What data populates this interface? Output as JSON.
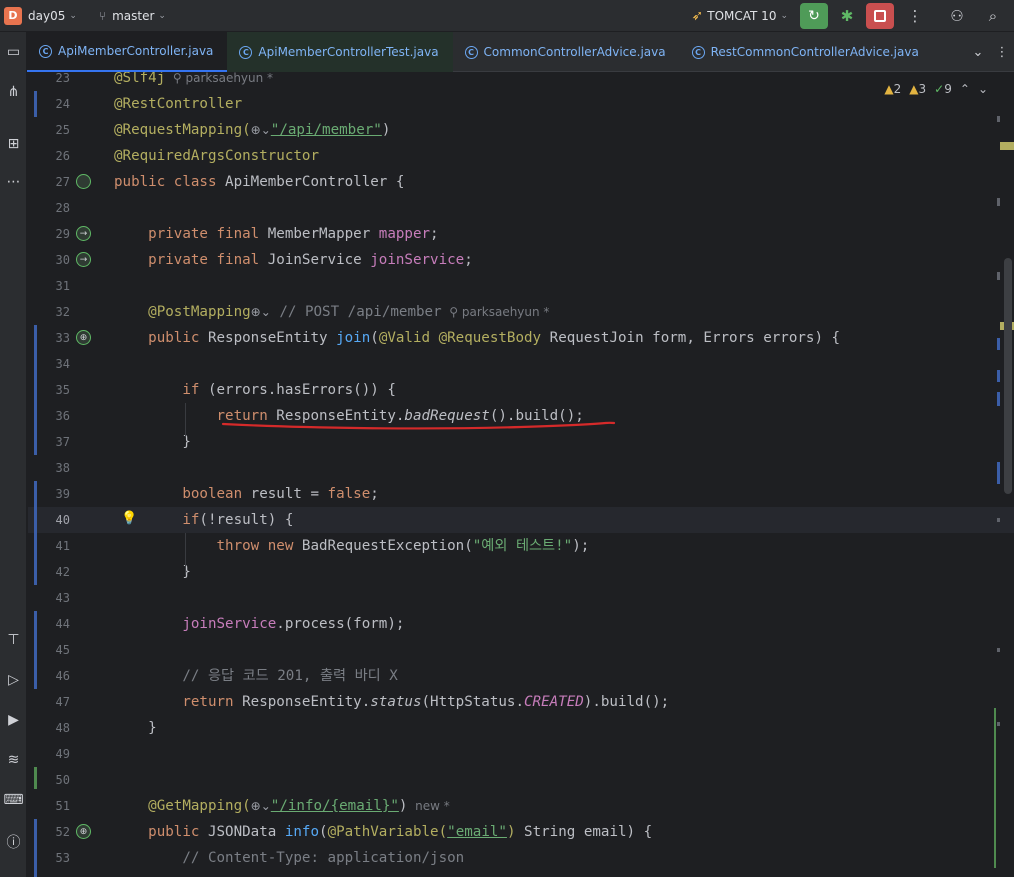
{
  "toolbar": {
    "project_badge": "D",
    "project_name": "day05",
    "branch": "master",
    "run_config": "TOMCAT 10"
  },
  "tabs": [
    {
      "label": "ApiMemberController.java",
      "active": true
    },
    {
      "label": "ApiMemberControllerTest.java",
      "modified": true
    },
    {
      "label": "CommonControllerAdvice.java"
    },
    {
      "label": "RestCommonControllerAdvice.java"
    }
  ],
  "inspections": {
    "warnings": "2",
    "weak_warnings": "3",
    "ok": "9"
  },
  "author_hint": "parksaehyun *",
  "new_hint": "new *",
  "code_lines": [
    {
      "n": "23",
      "tokens": [
        [
          "t-ann",
          "@Slf4j"
        ],
        [
          "t-meta",
          "  ⚲ parksaehyun *"
        ]
      ]
    },
    {
      "n": "24",
      "tokens": [
        [
          "t-ann",
          "@RestController"
        ]
      ]
    },
    {
      "n": "25",
      "tokens": [
        [
          "t-ann",
          "@RequestMapping("
        ],
        [
          "t-globe",
          "⊕⌄"
        ],
        [
          "t-str t-link",
          "\"/api/member\""
        ],
        [
          "t-plain",
          ")"
        ]
      ]
    },
    {
      "n": "26",
      "tokens": [
        [
          "t-ann",
          "@RequiredArgsConstructor"
        ]
      ]
    },
    {
      "n": "27",
      "tokens": [
        [
          "t-kw",
          "public class "
        ],
        [
          "t-plain",
          "ApiMemberController {"
        ]
      ]
    },
    {
      "n": "28",
      "tokens": []
    },
    {
      "n": "29",
      "tokens": [
        [
          "t-kw",
          "    private final "
        ],
        [
          "t-plain",
          "MemberMapper "
        ],
        [
          "t-field",
          "mapper"
        ],
        [
          "t-plain",
          ";"
        ]
      ]
    },
    {
      "n": "30",
      "tokens": [
        [
          "t-kw",
          "    private final "
        ],
        [
          "t-plain",
          "JoinService "
        ],
        [
          "t-field",
          "joinService"
        ],
        [
          "t-plain",
          ";"
        ]
      ]
    },
    {
      "n": "31",
      "tokens": []
    },
    {
      "n": "32",
      "tokens": [
        [
          "t-ann",
          "    @PostMapping"
        ],
        [
          "t-globe",
          "⊕⌄"
        ],
        [
          "t-cmt",
          " // POST /api/member"
        ],
        [
          "t-meta",
          "  ⚲ parksaehyun *"
        ]
      ]
    },
    {
      "n": "33",
      "tokens": [
        [
          "t-kw",
          "    public "
        ],
        [
          "t-plain",
          "ResponseEntity "
        ],
        [
          "t-fn",
          "join"
        ],
        [
          "t-plain",
          "("
        ],
        [
          "t-ann",
          "@Valid @RequestBody "
        ],
        [
          "t-plain",
          "RequestJoin form, Errors errors) {"
        ]
      ]
    },
    {
      "n": "34",
      "tokens": []
    },
    {
      "n": "35",
      "tokens": [
        [
          "t-kw",
          "        if "
        ],
        [
          "t-plain",
          "(errors.hasErrors()) {"
        ]
      ]
    },
    {
      "n": "36",
      "tokens": [
        [
          "t-kw",
          "            return "
        ],
        [
          "t-plain",
          "ResponseEntity."
        ],
        [
          "t-plain t-italic",
          "badRequest"
        ],
        [
          "t-plain",
          "().build();"
        ]
      ]
    },
    {
      "n": "37",
      "tokens": [
        [
          "t-plain",
          "        }"
        ]
      ]
    },
    {
      "n": "38",
      "tokens": []
    },
    {
      "n": "39",
      "tokens": [
        [
          "t-kw",
          "        boolean "
        ],
        [
          "t-plain",
          "result = "
        ],
        [
          "t-kw",
          "false"
        ],
        [
          "t-plain",
          ";"
        ]
      ]
    },
    {
      "n": "40",
      "tokens": [
        [
          "t-kw",
          "        if"
        ],
        [
          "t-plain",
          "(!result) {"
        ]
      ]
    },
    {
      "n": "41",
      "tokens": [
        [
          "t-kw",
          "            throw new "
        ],
        [
          "t-plain",
          "BadRequestException("
        ],
        [
          "t-str",
          "\"예외 테스트!\""
        ],
        [
          "t-plain",
          ");"
        ]
      ]
    },
    {
      "n": "42",
      "tokens": [
        [
          "t-plain",
          "        }"
        ]
      ]
    },
    {
      "n": "43",
      "tokens": []
    },
    {
      "n": "44",
      "tokens": [
        [
          "t-field",
          "        joinService"
        ],
        [
          "t-plain",
          ".process(form);"
        ]
      ]
    },
    {
      "n": "45",
      "tokens": []
    },
    {
      "n": "46",
      "tokens": [
        [
          "t-cmt",
          "        // 응답 코드 201, 출력 바디 X"
        ]
      ]
    },
    {
      "n": "47",
      "tokens": [
        [
          "t-kw",
          "        return "
        ],
        [
          "t-plain",
          "ResponseEntity."
        ],
        [
          "t-plain t-italic",
          "status"
        ],
        [
          "t-plain",
          "(HttpStatus."
        ],
        [
          "t-const",
          "CREATED"
        ],
        [
          "t-plain",
          ").build();"
        ]
      ]
    },
    {
      "n": "48",
      "tokens": [
        [
          "t-plain",
          "    }"
        ]
      ]
    },
    {
      "n": "49",
      "tokens": []
    },
    {
      "n": "50",
      "tokens": []
    },
    {
      "n": "51",
      "tokens": [
        [
          "t-ann",
          "    @GetMapping("
        ],
        [
          "t-globe",
          "⊕⌄"
        ],
        [
          "t-str t-link",
          "\"/info/{email}\""
        ],
        [
          "t-plain",
          ")"
        ],
        [
          "t-meta",
          "  new *"
        ]
      ]
    },
    {
      "n": "52",
      "tokens": [
        [
          "t-kw",
          "    public "
        ],
        [
          "t-plain",
          "JSONData "
        ],
        [
          "t-fn",
          "info"
        ],
        [
          "t-plain",
          "("
        ],
        [
          "t-ann",
          "@PathVariable("
        ],
        [
          "t-str t-link",
          "\"email\""
        ],
        [
          "t-ann",
          ") "
        ],
        [
          "t-plain",
          "String email) {"
        ]
      ]
    },
    {
      "n": "53",
      "tokens": [
        [
          "t-cmt",
          "        // Content-Type: application/json"
        ]
      ]
    }
  ],
  "colors": {
    "accent": "#3574f0",
    "run": "#4f9b58",
    "stop": "#c94f4f",
    "annotation_red": "#d52a2a"
  }
}
